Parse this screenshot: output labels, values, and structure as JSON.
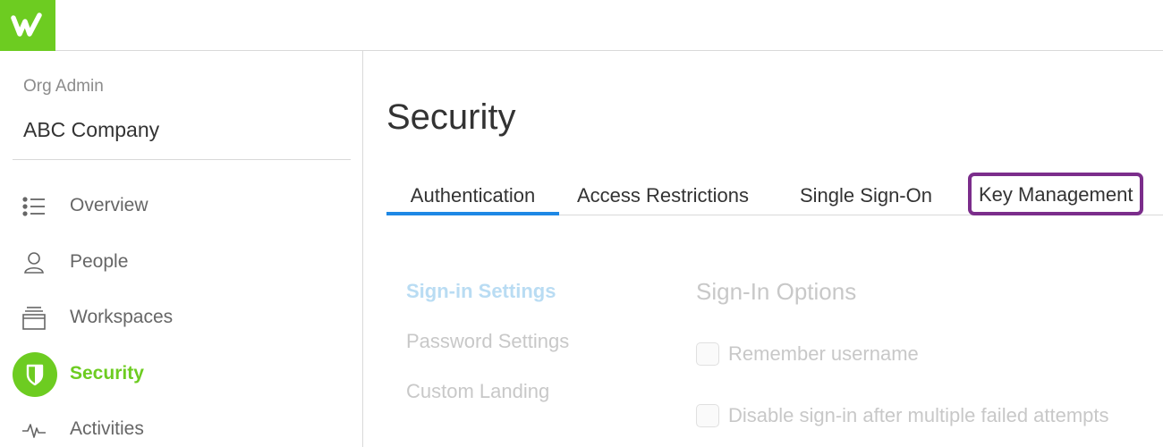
{
  "app": {
    "logo_icon": "workfront-w-logo",
    "brand_color": "#6dcc21"
  },
  "sidebar": {
    "section_label": "Org Admin",
    "org_name": "ABC Company",
    "items": [
      {
        "label": "Overview",
        "icon": "list-icon"
      },
      {
        "label": "People",
        "icon": "person-icon"
      },
      {
        "label": "Workspaces",
        "icon": "workspaces-icon"
      },
      {
        "label": "Security",
        "icon": "shield-icon",
        "active": true
      },
      {
        "label": "Activities",
        "icon": "activity-icon"
      }
    ]
  },
  "main": {
    "title": "Security",
    "tabs": [
      {
        "label": "Authentication",
        "active": true
      },
      {
        "label": "Access Restrictions"
      },
      {
        "label": "Single Sign-On"
      },
      {
        "label": "Key Management",
        "highlighted": true
      }
    ],
    "subnav": [
      {
        "label": "Sign-in Settings",
        "active": true
      },
      {
        "label": "Password Settings"
      },
      {
        "label": "Custom Landing"
      }
    ],
    "section_title": "Sign-In Options",
    "options": [
      {
        "label": "Remember username",
        "checked": false
      },
      {
        "label": "Disable sign-in after multiple failed attempts",
        "checked": false
      }
    ]
  },
  "colors": {
    "active_tab_underline": "#1e88e5",
    "highlight_box": "#7b2d8b",
    "active_nav": "#6dcc21"
  }
}
